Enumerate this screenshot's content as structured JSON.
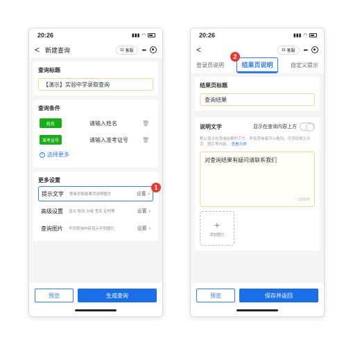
{
  "left": {
    "status": {
      "time": "20:26"
    },
    "nav": {
      "back": "<",
      "title": "新建查询",
      "service": "客服",
      "more": "•••"
    },
    "query_title": {
      "heading": "查询标题",
      "value": "【演示】实验中学录取查询"
    },
    "conditions": {
      "heading": "查询条件",
      "items": [
        {
          "tag": "姓名",
          "placeholder": "请输入姓名"
        },
        {
          "tag": "准考证号",
          "placeholder": "请输入准考证号"
        }
      ],
      "select_more": "选择更多"
    },
    "more_settings": {
      "heading": "更多设置",
      "items": [
        {
          "label": "提示文字",
          "desc": "登录页和结果页说明图文",
          "action": "设置"
        },
        {
          "label": "高级设置",
          "desc": "显示 修改 分组 签名 定时等",
          "action": "设置"
        },
        {
          "label": "查询图片",
          "desc": "不同查询内容显示不同图片",
          "action": "设置"
        }
      ]
    },
    "buttons": {
      "preview": "预览",
      "primary": "生成查询"
    },
    "badge": "1"
  },
  "right": {
    "status": {
      "time": "20:26"
    },
    "nav": {
      "back": "<",
      "service": "客服",
      "more": "•••"
    },
    "tabs": [
      "登录页说明",
      "结果页说明",
      "自定义提示"
    ],
    "result_title": {
      "heading": "结果页标题",
      "value": "查询结果"
    },
    "desc": {
      "heading": "说明文字",
      "toggle_label": "显示在查询内容上方",
      "help": "默认显示在查询结果的下方，所有查询者可以看到，可添加提示文字、图片等内容。",
      "help_link": "查看示例",
      "text": "对查询结果有疑问请联系我们",
      "count": "13/600",
      "add_image": "添加图片"
    },
    "buttons": {
      "preview": "预览",
      "primary": "保存并返回"
    },
    "badge": "2"
  },
  "colors": {
    "accent": "#2e7de6",
    "green": "#1aad19",
    "badge": "#e53935"
  }
}
